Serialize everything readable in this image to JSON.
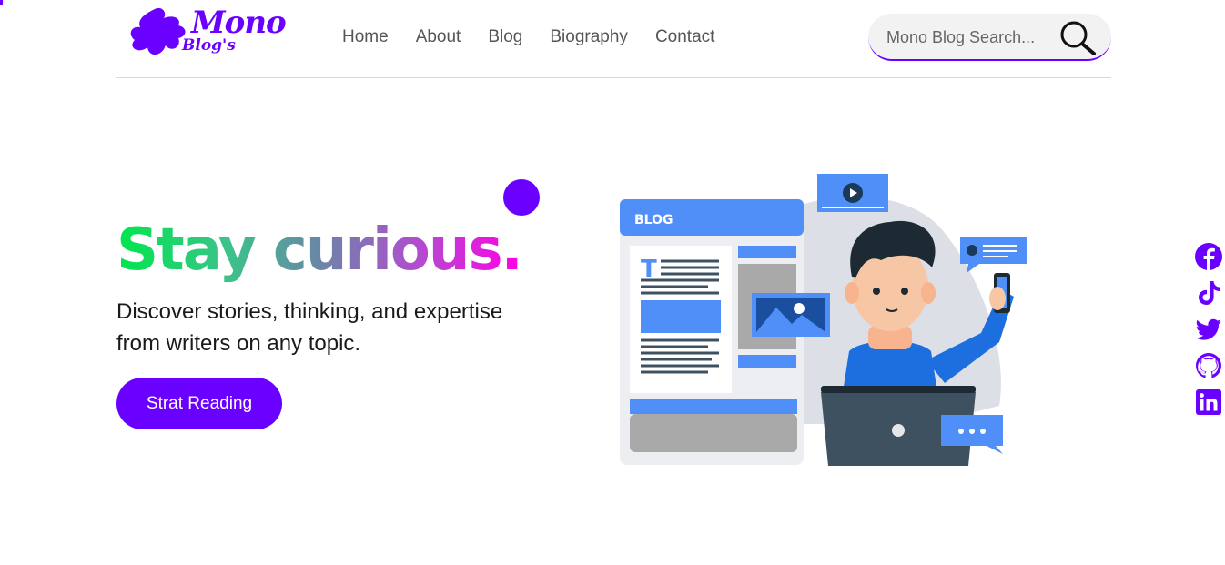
{
  "brand": {
    "name": "Mono",
    "sub": "Blog's",
    "color": "#6a00ff"
  },
  "nav": {
    "items": [
      {
        "label": "Home"
      },
      {
        "label": "About"
      },
      {
        "label": "Blog"
      },
      {
        "label": "Biography"
      },
      {
        "label": "Contact"
      }
    ]
  },
  "search": {
    "placeholder": "Mono Blog Search...",
    "icon": "magnifier-icon"
  },
  "hero": {
    "title": "Stay curious.",
    "description": "Discover stories, thinking, and expertise from writers on any topic.",
    "cta_label": "Strat Reading"
  },
  "illustration": {
    "blog_label": "BLOG"
  },
  "social": {
    "icons": [
      "facebook-icon",
      "tiktok-icon",
      "twitter-icon",
      "github-icon",
      "linkedin-icon"
    ]
  }
}
